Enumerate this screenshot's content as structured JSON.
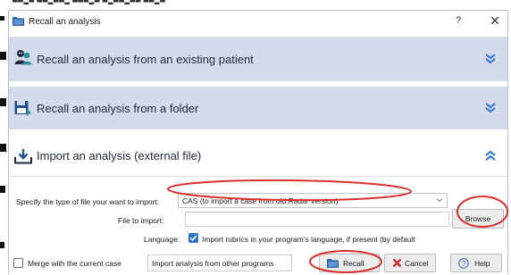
{
  "window": {
    "title": "Recall an analysis",
    "help_glyph": "?",
    "close_glyph": "✕"
  },
  "sections": [
    {
      "label": "Recall an analysis from an existing patient",
      "icon": "patients-icon",
      "state": "collapsed"
    },
    {
      "label": "Recall an analysis from a folder",
      "icon": "floppy-save-icon",
      "state": "collapsed"
    },
    {
      "label": "Import an analysis (external file)",
      "icon": "import-tray-icon",
      "state": "expanded"
    }
  ],
  "import": {
    "type_label": "Specify the type of file your want to import:",
    "type_value": "CAS (to import a case from old Radar version)",
    "file_label": "File to import:",
    "file_value": "",
    "browse_label": "Browse",
    "language_label": "Language:",
    "language_option": "Import rubrics in your program's language, if present (by default",
    "language_checked": true
  },
  "footer": {
    "merge_label": "Merge with the current case",
    "merge_checked": false,
    "comment_value": "Import analysis from other programs",
    "recall_label": "Recall",
    "cancel_label": "Cancel",
    "help_label": "Help"
  },
  "colors": {
    "section_bg": "#d4dceb",
    "chevron": "#3a7bd5",
    "annotation_red": "#d9302c",
    "checkbox_blue": "#2a72c9"
  }
}
